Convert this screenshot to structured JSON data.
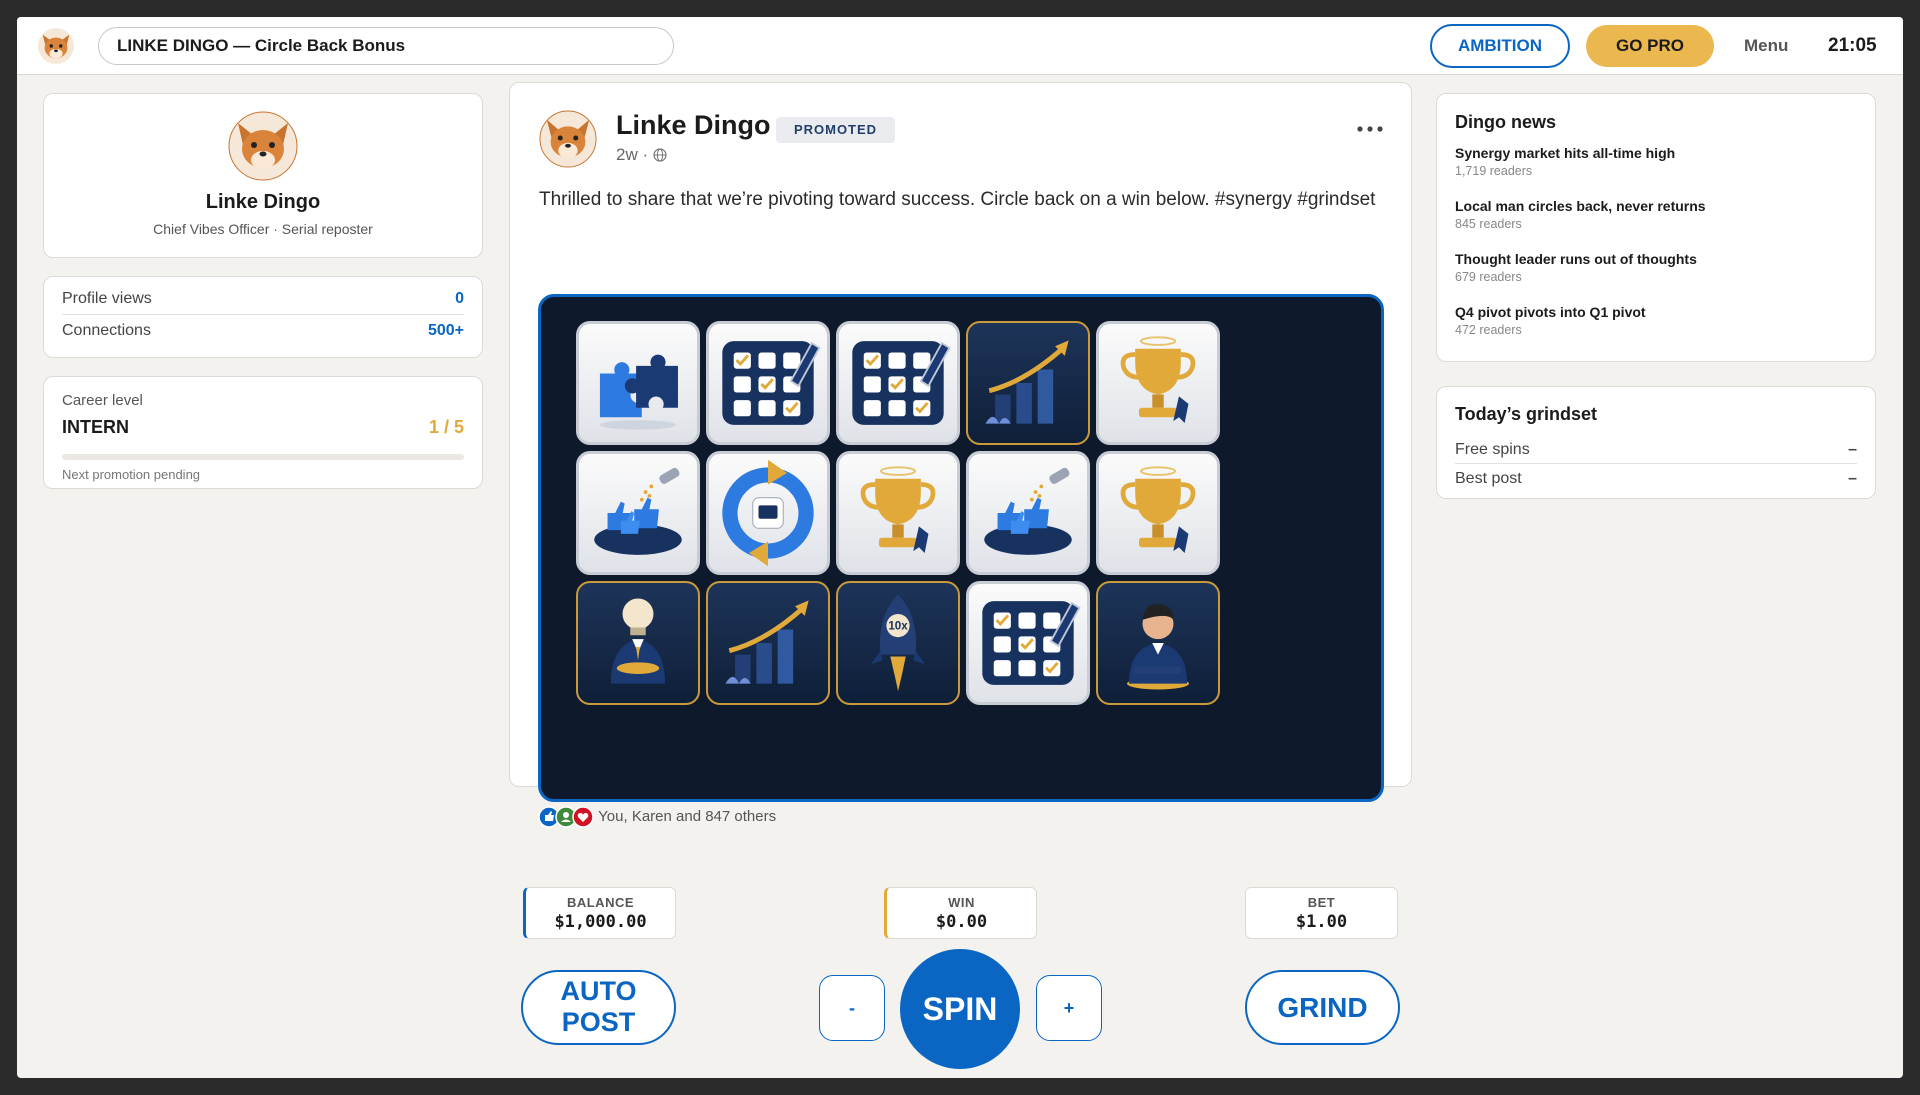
{
  "topbar": {
    "search_value": "LINKE DINGO — Circle Back Bonus",
    "ambition_label": "AMBITION",
    "gopro_label": "GO PRO",
    "menu_label": "Menu",
    "clock": "21:05"
  },
  "profile": {
    "name": "Linke Dingo",
    "subtitle": "Chief Vibes Officer · Serial reposter"
  },
  "stats": [
    {
      "label": "Profile views",
      "value": "0"
    },
    {
      "label": "Connections",
      "value": "500+"
    }
  ],
  "career": {
    "label": "Career level",
    "level": "INTERN",
    "count": "1 / 5",
    "progress_fraction": 0,
    "note": "Next promotion pending"
  },
  "post": {
    "author": "Linke Dingo",
    "badge": "PROMOTED",
    "age": "2w ·",
    "text": "Thrilled to share that we’re pivoting toward success. Circle back on a win below. #synergy #grindset",
    "reactions_text": "You, Karen and 847 others"
  },
  "reels": {
    "rows": [
      [
        "puzzle-icon",
        "checklist-icon",
        "checklist-icon",
        "growth-chart-icon",
        "trophy-icon"
      ],
      [
        "likes-fountain-icon",
        "refresh-cycle-icon",
        "trophy-icon",
        "likes-fountain-icon",
        "trophy-icon"
      ],
      [
        "lightbulb-executive-icon",
        "growth-chart-icon",
        "rocket-10x-icon",
        "checklist-icon",
        "executive-portrait-icon"
      ]
    ]
  },
  "news": {
    "title": "Dingo news",
    "items": [
      {
        "headline": "Synergy market hits all-time high",
        "readers": "1,719 readers"
      },
      {
        "headline": "Local man circles back, never returns",
        "readers": "845 readers"
      },
      {
        "headline": "Thought leader runs out of thoughts",
        "readers": "679 readers"
      },
      {
        "headline": "Q4 pivot pivots into Q1 pivot",
        "readers": "472 readers"
      }
    ]
  },
  "grindset": {
    "title": "Today’s grindset",
    "rows": [
      {
        "label": "Free spins",
        "value": "–"
      },
      {
        "label": "Best post",
        "value": "–"
      }
    ]
  },
  "controls": {
    "balance_label": "BALANCE",
    "balance_value": "$1,000.00",
    "win_label": "WIN",
    "win_value": "$0.00",
    "bet_label": "BET",
    "bet_value": "$1.00",
    "autopost_line1": "AUTO",
    "autopost_line2": "POST",
    "minus_label": "-",
    "spin_label": "SPIN",
    "plus_label": "+",
    "grind_label": "GRIND"
  },
  "colors": {
    "accent": "#0a66c2",
    "gold": "#e0a93a",
    "reel_bg": "#0e1a2b",
    "page_bg": "#f3f2ef"
  }
}
